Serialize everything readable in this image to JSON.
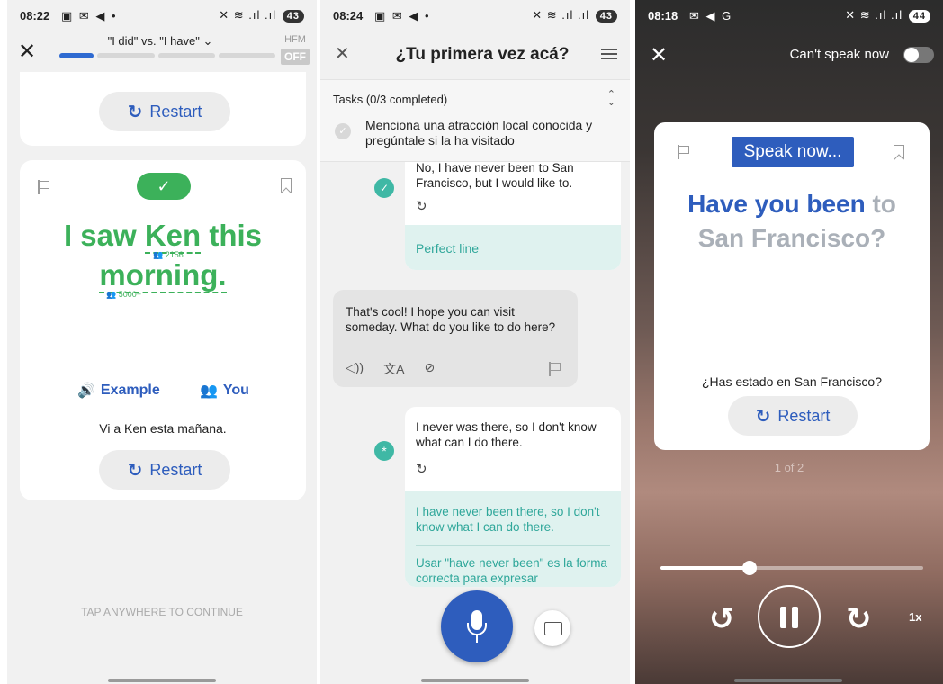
{
  "screen1": {
    "status": {
      "time": "08:22",
      "icons": "▣ ✉ ◀ •",
      "right_icons": "✕ ≋ .ıl .ıl",
      "battery": "43"
    },
    "lesson_title": "\"I did\" vs. \"I have\" ⌄",
    "progress": 0.16,
    "hfm_label": "HFM",
    "hfm_toggle": "OFF",
    "restart_label": "Restart",
    "check": "✓",
    "sentence": {
      "part1": "I saw ",
      "word_ken": "Ken",
      "part2": " this",
      "word_morning": "morning."
    },
    "freq_ken": "👥 2156",
    "freq_morning": "👥 5000+",
    "example_label": "Example",
    "you_label": "You",
    "translation": "Vi a Ken esta mañana.",
    "restart_label2": "Restart",
    "tap_continue": "TAP ANYWHERE TO CONTINUE"
  },
  "screen2": {
    "status": {
      "time": "08:24",
      "icons": "▣ ✉ ◀ •",
      "right_icons": "✕ ≋ .ıl .ıl",
      "battery": "43"
    },
    "title": "¿Tu primera vez acá?",
    "tasks_header": "Tasks (0/3 completed)",
    "task_text": "Menciona una atracción local conocida y pregúntale si la ha visitado",
    "msg1": "No, I have never been to San Francisco, but I would like to.",
    "perfect": "Perfect line",
    "msg2": "That's cool! I hope you can visit someday. What do you like to do here?",
    "msg3": "I never was there, so I don't know what can I do there.",
    "correction": "I have never been there, so I don't know what I can do there.",
    "explanation": "Usar \"have never been\" es la forma correcta para expresar"
  },
  "screen3": {
    "status": {
      "time": "08:18",
      "icons": "✉ ◀ G",
      "right_icons": "✕ ≋ .ıl .ıl",
      "battery": "44"
    },
    "cant_speak": "Can't speak now",
    "speak_now": "Speak now...",
    "prompt_said": "Have you been",
    "prompt_rest1": " to",
    "prompt_line2": "San Francisco?",
    "spanish": "¿Has estado en San Francisco?",
    "restart_label": "Restart",
    "page_counter": "1 of 2",
    "playback_progress": 0.34,
    "speed": "1x"
  },
  "icons": {
    "close": "✕",
    "restart": "↻",
    "speaker": "🔊",
    "you": "👥",
    "redo": "↻",
    "audio": "◁))",
    "translate": "文A",
    "hide": "⊘",
    "rewind": "↺",
    "forward": "↻"
  },
  "colors": {
    "accent_blue": "#2e5dbd",
    "success_green": "#3cb15a",
    "teal": "#2fa79a"
  }
}
